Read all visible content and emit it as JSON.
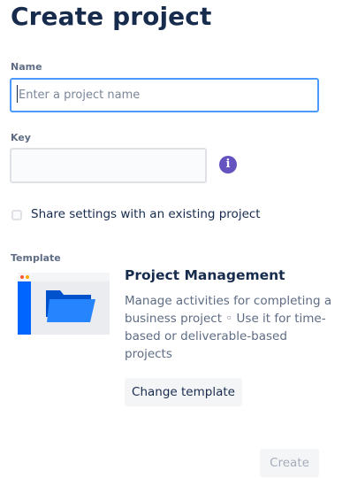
{
  "page": {
    "title": "Create project"
  },
  "form": {
    "name_label": "Name",
    "name_placeholder": "Enter a project name",
    "name_value": "",
    "key_label": "Key",
    "key_value": "",
    "info_icon": "info-icon",
    "share_label": "Share settings with an existing project",
    "share_checked": false
  },
  "template": {
    "section_label": "Template",
    "name": "Project Management",
    "description": "Manage activities for completing a business project ◦ Use it for time-based or deliverable-based projects",
    "change_label": "Change template",
    "image_icon": "folder-icon"
  },
  "actions": {
    "create_label": "Create",
    "create_disabled": true
  },
  "colors": {
    "title": "#172b4d",
    "label": "#5e6c84",
    "focus_border": "#4c9aff",
    "info_icon": "#6554c0",
    "folder": "#2684ff",
    "disabled_text": "#a5adba"
  }
}
